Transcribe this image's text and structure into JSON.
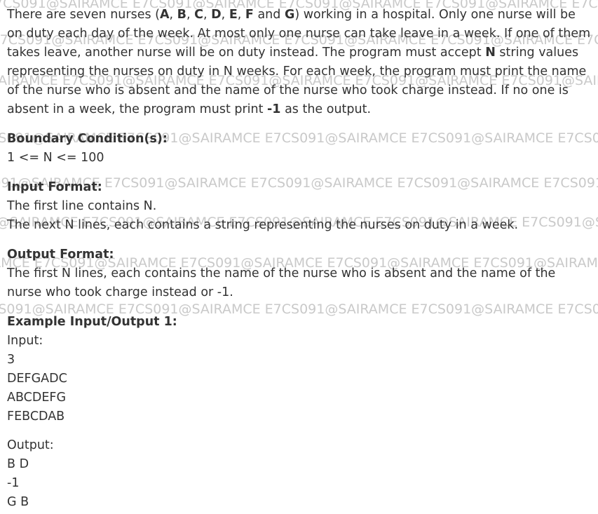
{
  "watermark": {
    "text": "E7CS091@SAIRAMCE"
  },
  "description": {
    "seg1": "There are seven nurses (",
    "n1": "A",
    "sep1": ", ",
    "n2": "B",
    "sep2": ", ",
    "n3": "C",
    "sep3": ", ",
    "n4": "D",
    "sep4": ", ",
    "n5": "E",
    "sep5": ", ",
    "n6": "F",
    "sep6": " and ",
    "n7": "G",
    "seg2": ") working in a hospital. Only one nurse will be on duty each day of the week. At most only one nurse can take leave in a week. If one of them takes leave, another nurse will be on duty instead. The program must accept ",
    "bold_N": "N",
    "seg3": " string values representing the nurses on duty in N weeks. For each week, the program must print the name of the nurse who is absent and the name of the nurse who took charge instead. If no one is absent in a week, the program must print ",
    "bold_minus1": "-1",
    "seg4": " as the output."
  },
  "boundary": {
    "heading": "Boundary Condition(s):",
    "line": "1 <= N <= 100"
  },
  "input_format": {
    "heading": "Input Format:",
    "lines": [
      "The first line contains N.",
      "The next N lines, each contains a string representing the nurses on duty in a week."
    ]
  },
  "output_format": {
    "heading": "Output Format:",
    "text": "The first N lines, each contains the name of the nurse who is absent and the name of the nurse who took charge instead or -1."
  },
  "example": {
    "heading": "Example Input/Output 1:",
    "input_label": "Input:",
    "input_lines": [
      "3",
      "DEFGADC",
      "ABCDEFG",
      "FEBCDAB"
    ],
    "output_label": "Output:",
    "output_lines": [
      "B D",
      "-1",
      "G B"
    ]
  }
}
